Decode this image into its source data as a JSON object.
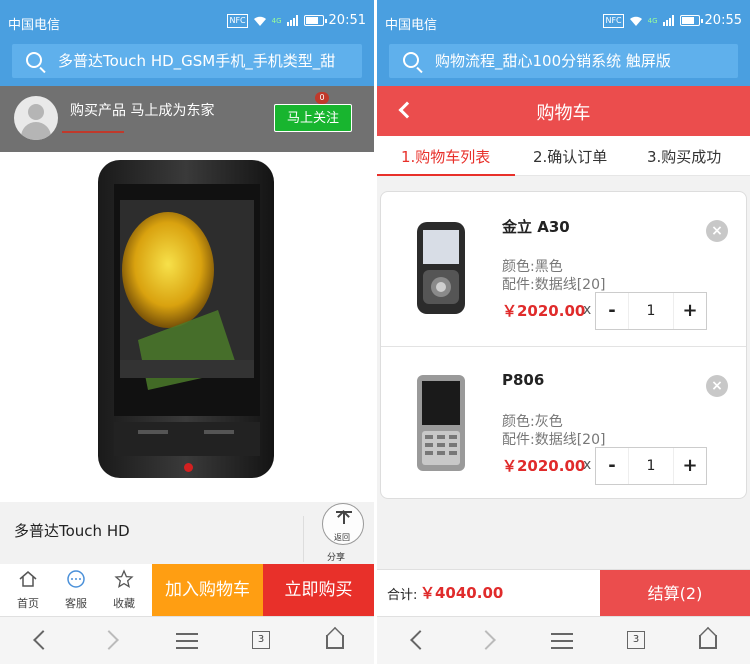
{
  "left": {
    "status": {
      "carrier": "中国电信",
      "time": "20:51",
      "nfc": "NFC",
      "net": "4G"
    },
    "search": {
      "text": "多普达Touch HD_GSM手机_手机类型_甜"
    },
    "follow": {
      "text": "购买产品 马上成为东家",
      "button": "马上关注",
      "badge": "0"
    },
    "product": {
      "name": "多普达Touch HD"
    },
    "share": {
      "back_top": "返回",
      "share_label": "分享"
    },
    "actions": [
      {
        "label": "首页",
        "icon": "home-icon"
      },
      {
        "label": "客服",
        "icon": "chat-icon"
      },
      {
        "label": "收藏",
        "icon": "star-icon"
      }
    ],
    "add_to_cart": "加入购物车",
    "buy_now": "立即购买",
    "nav": {
      "tabs_count": "3"
    }
  },
  "right": {
    "status": {
      "carrier": "中国电信",
      "time": "20:55",
      "nfc": "NFC",
      "net": "4G"
    },
    "search": {
      "text": "购物流程_甜心100分销系统 触屏版"
    },
    "header": {
      "title": "购物车"
    },
    "steps": [
      "1.购物车列表",
      "2.确认订单",
      "3.购买成功"
    ],
    "items": [
      {
        "name": "金立 A30",
        "color": "颜色:黑色",
        "parts": "配件:数据线[20]",
        "price": "￥2020.00",
        "times": "x",
        "qty": "1",
        "minus": "-",
        "plus": "+",
        "remove": "×"
      },
      {
        "name": "P806",
        "color": "颜色:灰色",
        "parts": "配件:数据线[20]",
        "price": "￥2020.00",
        "times": "x",
        "qty": "1",
        "minus": "-",
        "plus": "+",
        "remove": "×"
      }
    ],
    "total_label": "合计:",
    "total_value": "￥4040.00",
    "settle": "结算(2)",
    "nav": {
      "tabs_count": "3"
    }
  },
  "colors": {
    "blue": "#4a9fe0",
    "red": "#eb4d4d",
    "orange": "#ff9e12",
    "green": "#18b52f",
    "price": "#e02b2b"
  }
}
